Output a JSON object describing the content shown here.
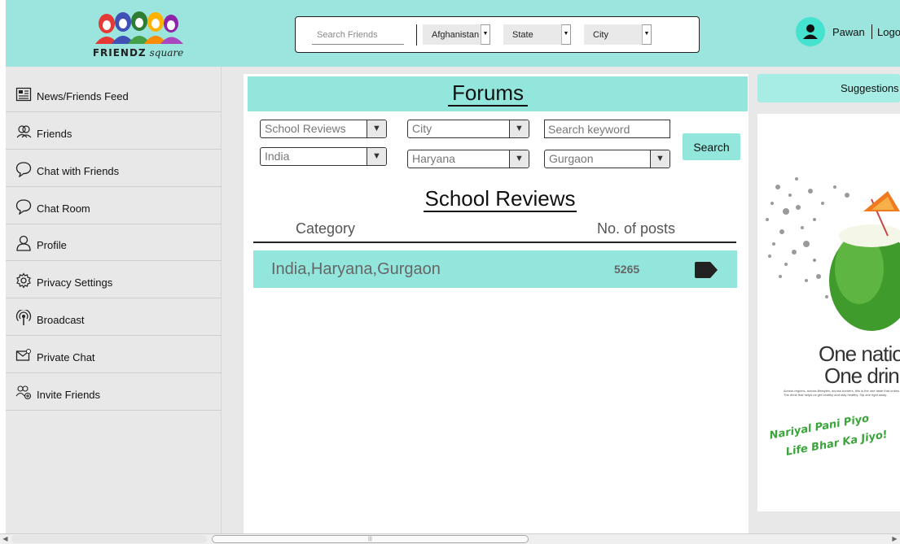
{
  "header": {
    "brand_main": "FRIENDZ",
    "brand_sub": "square",
    "search_placeholder": "Search Friends",
    "country_select": "Afghanistan",
    "state_select": "State",
    "city_select": "City",
    "username": "Pawan",
    "logout": "Logout"
  },
  "sidebar": {
    "items": [
      {
        "label": "News/Friends Feed",
        "icon": "newspaper-icon"
      },
      {
        "label": "Friends",
        "icon": "friends-icon"
      },
      {
        "label": "Chat with Friends",
        "icon": "chat-bubble-icon"
      },
      {
        "label": "Chat Room",
        "icon": "chat-bubble-icon"
      },
      {
        "label": "Profile",
        "icon": "user-icon"
      },
      {
        "label": "Privacy Settings",
        "icon": "gear-icon"
      },
      {
        "label": "Broadcast",
        "icon": "broadcast-icon"
      },
      {
        "label": "Private Chat",
        "icon": "envelope-icon"
      },
      {
        "label": "Invite Friends",
        "icon": "invite-users-icon"
      }
    ]
  },
  "forum": {
    "title": "Forums",
    "filters": {
      "type": "School Reviews",
      "country": "India",
      "city": "City",
      "state": "Haryana",
      "keyword_placeholder": "Search keyword",
      "city2": "Gurgaon"
    },
    "search_button": "Search",
    "section_title": "School Reviews",
    "columns": {
      "category": "Category",
      "posts": "No. of posts"
    },
    "rows": [
      {
        "category": "India,Haryana,Gurgaon",
        "posts": "5265"
      }
    ]
  },
  "right": {
    "suggestions": "Suggestions",
    "ad": {
      "line1": "One nation",
      "line2": "One drink",
      "fine_print": "Across regions, across lifestyles, across borders, this is the one taste that unites. The drink that helps us get healthy and stay healthy. Sip one right away.",
      "slogan1": "Nariyal Pani Piyo",
      "slogan2": "Life Bhar Ka Jiyo!"
    }
  },
  "colors": {
    "header_bg": "#9be5de",
    "accent": "#93e6dc",
    "avatar": "#45e2cf",
    "sidebar_bg": "#e8e8e8"
  }
}
